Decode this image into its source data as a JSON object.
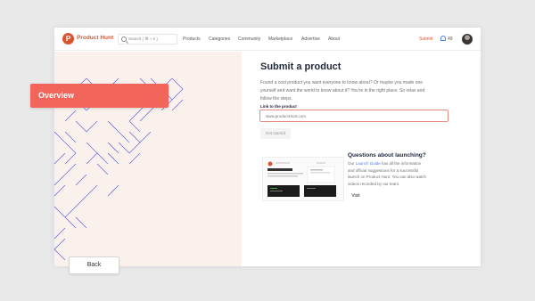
{
  "header": {
    "brand": "Product Hunt",
    "search_placeholder": "Search ( ⌘ + k )",
    "nav": [
      "Products",
      "Categories",
      "Community",
      "Marketplace",
      "Advertise",
      "About"
    ],
    "submit": "Submit",
    "notification_count": "49"
  },
  "main": {
    "title": "Submit a product",
    "description": "Found a cool product you want everyone to know about? Or maybe you made one yourself and want the world to know about it? You're in the right place. So relax and follow the steps.",
    "field_label": "Link to the product",
    "field_placeholder": "www.productHunt.com",
    "get_started": "Get started"
  },
  "help": {
    "title": "Questions about launching?",
    "desc_prefix": "Our ",
    "desc_link": "Launch Guide",
    "desc_suffix": " has all the information and official suggestions for a successful launch on Product Hunt. You can also watch videos recorded by our team.",
    "visit": "Visit"
  },
  "overlay": {
    "overview": "Overview",
    "back": "Back"
  },
  "colors": {
    "brand": "#da552f",
    "overview_tab": "#f1655a",
    "input_border": "#e88a80"
  }
}
